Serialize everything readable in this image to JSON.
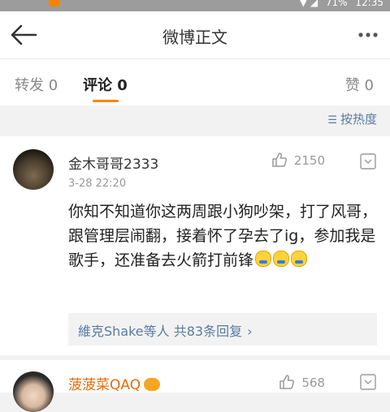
{
  "statusbar": {
    "signal": "▼ ◢",
    "battery": "71%",
    "time": "12:35"
  },
  "header": {
    "title": "微博正文",
    "back_icon": "arrow-left-icon",
    "more_icon": "more-icon"
  },
  "tabs": [
    {
      "label": "转发 0"
    },
    {
      "label": "评论 0"
    },
    {
      "label": "赞 0"
    }
  ],
  "sort": {
    "label": "按热度",
    "icon": "sort-icon"
  },
  "comments": [
    {
      "username": "金木哥哥2333",
      "timestamp": "3-28 22:20",
      "likes": "2150",
      "text": "你知不知道你这两周跟小狗吵架，打了风哥，跟管理层闹翻，接着怀了孕去了ig，参加我是歌手，还准备去火箭打前锋",
      "reply_summary": "維克Shake等人 共83条回复",
      "reply_chevron": "›"
    },
    {
      "username": "菠菠菜QAQ",
      "likes": "568"
    }
  ],
  "colors": {
    "accent": "#ff8200",
    "link": "#5a7aa3"
  }
}
